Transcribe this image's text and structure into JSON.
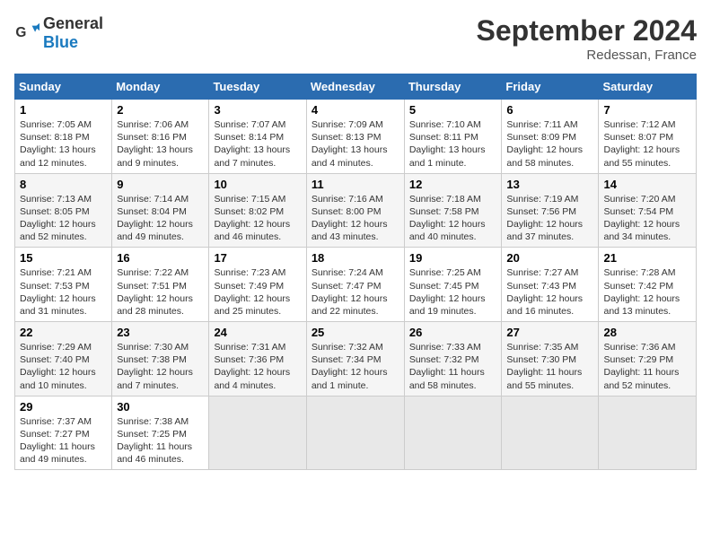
{
  "header": {
    "logo_general": "General",
    "logo_blue": "Blue",
    "month_title": "September 2024",
    "subtitle": "Redessan, France"
  },
  "weekdays": [
    "Sunday",
    "Monday",
    "Tuesday",
    "Wednesday",
    "Thursday",
    "Friday",
    "Saturday"
  ],
  "weeks": [
    [
      {
        "day": "1",
        "info": "Sunrise: 7:05 AM\nSunset: 8:18 PM\nDaylight: 13 hours and 12 minutes."
      },
      {
        "day": "2",
        "info": "Sunrise: 7:06 AM\nSunset: 8:16 PM\nDaylight: 13 hours and 9 minutes."
      },
      {
        "day": "3",
        "info": "Sunrise: 7:07 AM\nSunset: 8:14 PM\nDaylight: 13 hours and 7 minutes."
      },
      {
        "day": "4",
        "info": "Sunrise: 7:09 AM\nSunset: 8:13 PM\nDaylight: 13 hours and 4 minutes."
      },
      {
        "day": "5",
        "info": "Sunrise: 7:10 AM\nSunset: 8:11 PM\nDaylight: 13 hours and 1 minute."
      },
      {
        "day": "6",
        "info": "Sunrise: 7:11 AM\nSunset: 8:09 PM\nDaylight: 12 hours and 58 minutes."
      },
      {
        "day": "7",
        "info": "Sunrise: 7:12 AM\nSunset: 8:07 PM\nDaylight: 12 hours and 55 minutes."
      }
    ],
    [
      {
        "day": "8",
        "info": "Sunrise: 7:13 AM\nSunset: 8:05 PM\nDaylight: 12 hours and 52 minutes."
      },
      {
        "day": "9",
        "info": "Sunrise: 7:14 AM\nSunset: 8:04 PM\nDaylight: 12 hours and 49 minutes."
      },
      {
        "day": "10",
        "info": "Sunrise: 7:15 AM\nSunset: 8:02 PM\nDaylight: 12 hours and 46 minutes."
      },
      {
        "day": "11",
        "info": "Sunrise: 7:16 AM\nSunset: 8:00 PM\nDaylight: 12 hours and 43 minutes."
      },
      {
        "day": "12",
        "info": "Sunrise: 7:18 AM\nSunset: 7:58 PM\nDaylight: 12 hours and 40 minutes."
      },
      {
        "day": "13",
        "info": "Sunrise: 7:19 AM\nSunset: 7:56 PM\nDaylight: 12 hours and 37 minutes."
      },
      {
        "day": "14",
        "info": "Sunrise: 7:20 AM\nSunset: 7:54 PM\nDaylight: 12 hours and 34 minutes."
      }
    ],
    [
      {
        "day": "15",
        "info": "Sunrise: 7:21 AM\nSunset: 7:53 PM\nDaylight: 12 hours and 31 minutes."
      },
      {
        "day": "16",
        "info": "Sunrise: 7:22 AM\nSunset: 7:51 PM\nDaylight: 12 hours and 28 minutes."
      },
      {
        "day": "17",
        "info": "Sunrise: 7:23 AM\nSunset: 7:49 PM\nDaylight: 12 hours and 25 minutes."
      },
      {
        "day": "18",
        "info": "Sunrise: 7:24 AM\nSunset: 7:47 PM\nDaylight: 12 hours and 22 minutes."
      },
      {
        "day": "19",
        "info": "Sunrise: 7:25 AM\nSunset: 7:45 PM\nDaylight: 12 hours and 19 minutes."
      },
      {
        "day": "20",
        "info": "Sunrise: 7:27 AM\nSunset: 7:43 PM\nDaylight: 12 hours and 16 minutes."
      },
      {
        "day": "21",
        "info": "Sunrise: 7:28 AM\nSunset: 7:42 PM\nDaylight: 12 hours and 13 minutes."
      }
    ],
    [
      {
        "day": "22",
        "info": "Sunrise: 7:29 AM\nSunset: 7:40 PM\nDaylight: 12 hours and 10 minutes."
      },
      {
        "day": "23",
        "info": "Sunrise: 7:30 AM\nSunset: 7:38 PM\nDaylight: 12 hours and 7 minutes."
      },
      {
        "day": "24",
        "info": "Sunrise: 7:31 AM\nSunset: 7:36 PM\nDaylight: 12 hours and 4 minutes."
      },
      {
        "day": "25",
        "info": "Sunrise: 7:32 AM\nSunset: 7:34 PM\nDaylight: 12 hours and 1 minute."
      },
      {
        "day": "26",
        "info": "Sunrise: 7:33 AM\nSunset: 7:32 PM\nDaylight: 11 hours and 58 minutes."
      },
      {
        "day": "27",
        "info": "Sunrise: 7:35 AM\nSunset: 7:30 PM\nDaylight: 11 hours and 55 minutes."
      },
      {
        "day": "28",
        "info": "Sunrise: 7:36 AM\nSunset: 7:29 PM\nDaylight: 11 hours and 52 minutes."
      }
    ],
    [
      {
        "day": "29",
        "info": "Sunrise: 7:37 AM\nSunset: 7:27 PM\nDaylight: 11 hours and 49 minutes."
      },
      {
        "day": "30",
        "info": "Sunrise: 7:38 AM\nSunset: 7:25 PM\nDaylight: 11 hours and 46 minutes."
      },
      {
        "day": "",
        "info": ""
      },
      {
        "day": "",
        "info": ""
      },
      {
        "day": "",
        "info": ""
      },
      {
        "day": "",
        "info": ""
      },
      {
        "day": "",
        "info": ""
      }
    ]
  ]
}
